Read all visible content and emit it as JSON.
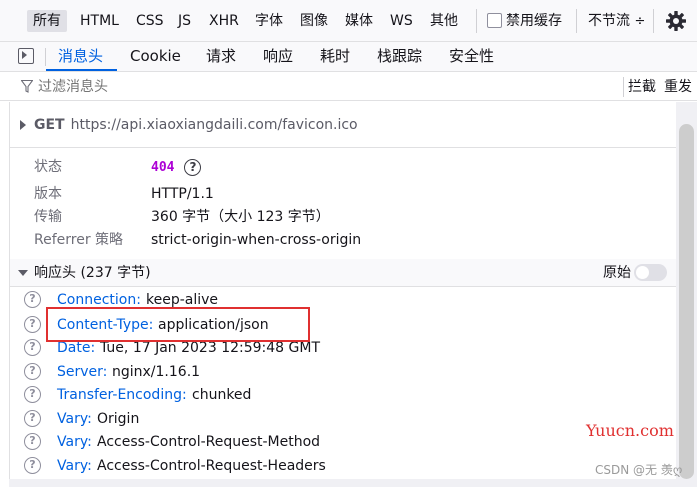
{
  "filter_bar": {
    "items": [
      "所有",
      "HTML",
      "CSS",
      "JS",
      "XHR",
      "字体",
      "图像",
      "媒体",
      "WS",
      "其他"
    ],
    "disable_cache_label": "禁用缓存",
    "throttle_label": "不节流",
    "throttle_arrow": "÷"
  },
  "tabs": [
    "消息头",
    "Cookie",
    "请求",
    "响应",
    "耗时",
    "栈跟踪",
    "安全性"
  ],
  "filter_headers": {
    "placeholder": "过滤消息头",
    "block_label": "拦截",
    "resend_label": "重发"
  },
  "request": {
    "method": "GET",
    "url": "https://api.xiaoxiangdaili.com/favicon.ico"
  },
  "summary": {
    "status_label": "状态",
    "status_value": "404",
    "version_label": "版本",
    "version_value": "HTTP/1.1",
    "transfer_label": "传输",
    "transfer_value": "360 字节（大小 123 字节）",
    "referrer_label": "Referrer 策略",
    "referrer_value": "strict-origin-when-cross-origin"
  },
  "response_headers": {
    "title": "响应头 (237 字节)",
    "raw_label": "原始",
    "raw_enabled": false,
    "rows": [
      {
        "name": "Connection:",
        "value": "keep-alive"
      },
      {
        "name": "Content-Type:",
        "value": "application/json"
      },
      {
        "name": "Date:",
        "value": "Tue, 17 Jan 2023 12:59:48 GMT"
      },
      {
        "name": "Server:",
        "value": "nginx/1.16.1"
      },
      {
        "name": "Transfer-Encoding:",
        "value": "chunked"
      },
      {
        "name": "Vary:",
        "value": "Origin"
      },
      {
        "name": "Vary:",
        "value": "Access-Control-Request-Method"
      },
      {
        "name": "Vary:",
        "value": "Access-Control-Request-Headers"
      }
    ]
  },
  "watermarks": {
    "site": "Yuucn.com",
    "csdn": "CSDN @无 羡ღ"
  },
  "colors": {
    "accent": "#0061e0",
    "status_404": "#ad00d6",
    "highlight": "#e03030"
  }
}
